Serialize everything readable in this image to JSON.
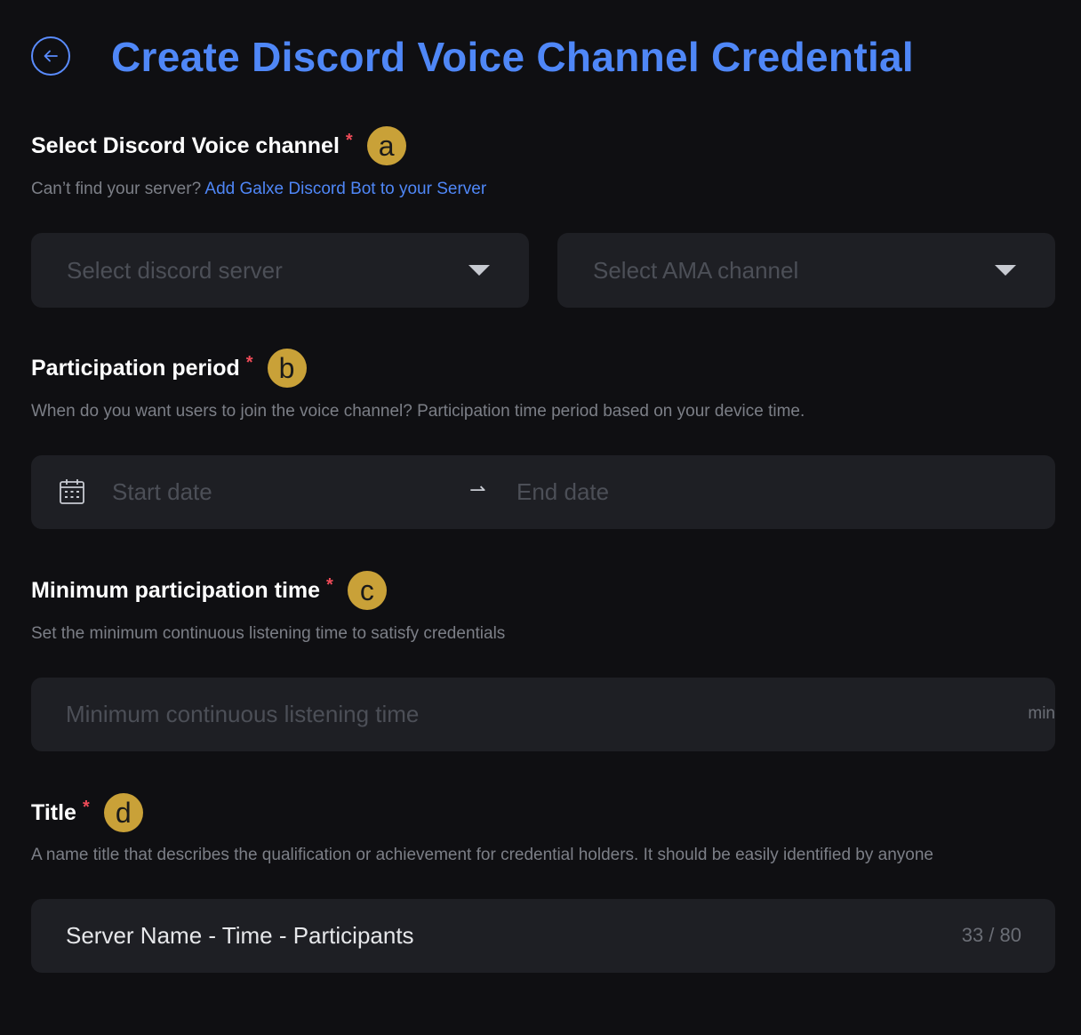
{
  "header": {
    "title": "Create Discord Voice Channel Credential"
  },
  "sections": {
    "channel": {
      "label": "Select Discord Voice channel",
      "required_mark": "*",
      "badge": "a",
      "desc_prefix": "Can’t find your server?",
      "desc_link": "Add Galxe Discord Bot to your Server",
      "server_placeholder": "Select discord server",
      "channel_placeholder": "Select AMA channel"
    },
    "period": {
      "label": "Participation period",
      "required_mark": "*",
      "badge": "b",
      "desc": "When do you want users to join the voice channel?  Participation time period based on your device time.",
      "start_placeholder": "Start date",
      "arrow": "⇀",
      "end_placeholder": "End date"
    },
    "min_time": {
      "label": "Minimum participation time",
      "required_mark": "*",
      "badge": "c",
      "desc": "Set the minimum continuous listening time to satisfy credentials",
      "placeholder": "Minimum continuous listening time",
      "unit": "min"
    },
    "title": {
      "label": "Title",
      "required_mark": "*",
      "badge": "d",
      "desc": "A name title that describes the qualification or achievement for credential holders. It should be easily identified by anyone",
      "value": "Server Name - Time - Participants",
      "counter": "33 / 80"
    }
  },
  "colors": {
    "background": "#0f0f12",
    "field": "#1e1f24",
    "accent": "#4f87f7",
    "badge": "#c9a138",
    "required": "#ee4b58"
  },
  "icons": {
    "back": "arrow-left-icon",
    "calendar": "calendar-icon",
    "dropdown": "caret-down-icon"
  }
}
